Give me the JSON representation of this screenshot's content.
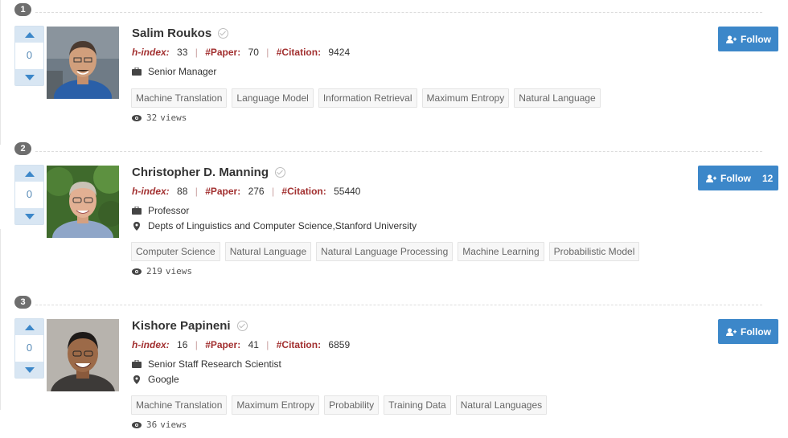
{
  "colors": {
    "accent": "#3c87c9",
    "label_red": "#a23030",
    "rank_badge": "#6e6e6e",
    "vote_blue": "#d8e6f3"
  },
  "labels": {
    "hindex": "h-index:",
    "paper": "#Paper:",
    "citation": "#Citation:",
    "views_suffix": "views"
  },
  "experts": [
    {
      "rank": "1",
      "votes": "0",
      "name": "Salim Roukos",
      "hindex": "33",
      "papers": "70",
      "citations": "9424",
      "position": "Senior Manager",
      "affiliation": "",
      "tags": [
        "Machine Translation",
        "Language Model",
        "Information Retrieval",
        "Maximum Entropy",
        "Natural Language"
      ],
      "views": "32",
      "follow_label": "Follow",
      "follow_count": ""
    },
    {
      "rank": "2",
      "votes": "0",
      "name": "Christopher D. Manning",
      "hindex": "88",
      "papers": "276",
      "citations": "55440",
      "position": "Professor",
      "affiliation": "Depts of Linguistics and Computer Science,Stanford University",
      "tags": [
        "Computer Science",
        "Natural Language",
        "Natural Language Processing",
        "Machine Learning",
        "Probabilistic Model"
      ],
      "views": "219",
      "follow_label": "Follow",
      "follow_count": "12"
    },
    {
      "rank": "3",
      "votes": "0",
      "name": "Kishore Papineni",
      "hindex": "16",
      "papers": "41",
      "citations": "6859",
      "position": "Senior Staff Research Scientist",
      "affiliation": "Google",
      "tags": [
        "Machine Translation",
        "Maximum Entropy",
        "Probability",
        "Training Data",
        "Natural Languages"
      ],
      "views": "36",
      "follow_label": "Follow",
      "follow_count": ""
    }
  ]
}
